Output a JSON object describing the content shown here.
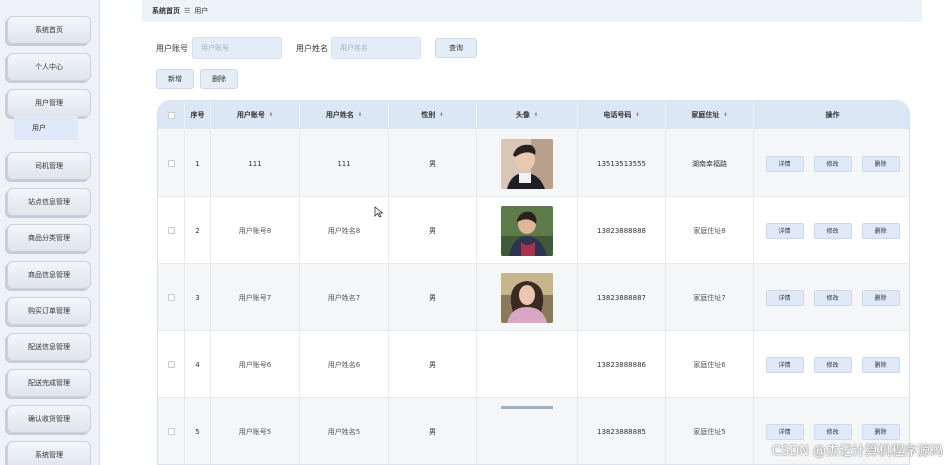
{
  "sidebar": {
    "items": [
      {
        "label": "系统首页"
      },
      {
        "label": "个人中心"
      },
      {
        "label": "用户管理"
      },
      {
        "label": "司机管理"
      },
      {
        "label": "站点信息管理"
      },
      {
        "label": "商品分类管理"
      },
      {
        "label": "商品信息管理"
      },
      {
        "label": "购买订单管理"
      },
      {
        "label": "配送信息管理"
      },
      {
        "label": "配送完成管理"
      },
      {
        "label": "确认收货管理"
      },
      {
        "label": "系统管理"
      }
    ],
    "sub_item": "用户"
  },
  "breadcrumb": {
    "home": "系统首页",
    "separator": "☰",
    "current": "用户"
  },
  "search": {
    "account_label": "用户账号",
    "account_placeholder": "用户账号",
    "name_label": "用户姓名",
    "name_placeholder": "用户姓名",
    "query_button": "查询"
  },
  "toolbar": {
    "add": "新增",
    "delete": "删除"
  },
  "table": {
    "headers": {
      "index": "序号",
      "account": "用户账号",
      "name": "用户姓名",
      "gender": "性别",
      "avatar": "头像",
      "phone": "电话号码",
      "address": "家庭住址",
      "actions": "操作"
    },
    "rows": [
      {
        "index": "1",
        "account": "111",
        "name": "111",
        "gender": "男",
        "phone": "13513513555",
        "address": "湖南幸福路"
      },
      {
        "index": "2",
        "account": "用户账号8",
        "name": "用户姓名8",
        "gender": "男",
        "phone": "13823888888",
        "address": "家庭住址8"
      },
      {
        "index": "3",
        "account": "用户账号7",
        "name": "用户姓名7",
        "gender": "男",
        "phone": "13823888887",
        "address": "家庭住址7"
      },
      {
        "index": "4",
        "account": "用户账号6",
        "name": "用户姓名6",
        "gender": "男",
        "phone": "13823888886",
        "address": "家庭住址6"
      },
      {
        "index": "5",
        "account": "用户账号5",
        "name": "用户姓名5",
        "gender": "男",
        "phone": "13823888885",
        "address": "家庭住址5"
      }
    ],
    "actions": {
      "detail": "详情",
      "edit": "修改",
      "delete": "删除"
    }
  },
  "watermark": "CSDN @杰记计算机程序源码",
  "colors": {
    "header_bg": "#dce7f6",
    "button_bg": "#e4ecf8",
    "sidebar_bg": "#eef2f7"
  }
}
